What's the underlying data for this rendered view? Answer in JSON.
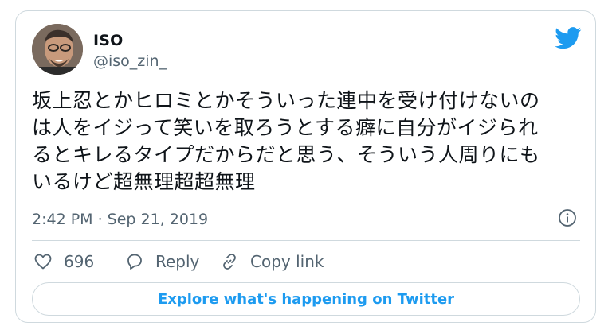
{
  "author": {
    "name": "ISO",
    "handle": "@iso_zin_"
  },
  "tweet": {
    "lines": [
      "坂上忍とかヒロミとかそういった連中を受け付けないの",
      "は人をイジって笑いを取ろうとする癖に自分がイジられ",
      "るとキレるタイプだからだと思う、そういう人周りにも",
      "いるけど超無理超超無理"
    ],
    "timestamp": "2:42 PM · Sep 21, 2019"
  },
  "actions": {
    "like_count": "696",
    "reply_label": "Reply",
    "copy_link_label": "Copy link"
  },
  "explore_label": "Explore what's happening on Twitter",
  "colors": {
    "twitter_blue": "#1d9bf0",
    "muted_text": "#536471",
    "border": "#cfd9de"
  },
  "icons": [
    "avatar",
    "twitter-bird-icon",
    "info-icon",
    "heart-icon",
    "reply-icon",
    "link-icon"
  ]
}
